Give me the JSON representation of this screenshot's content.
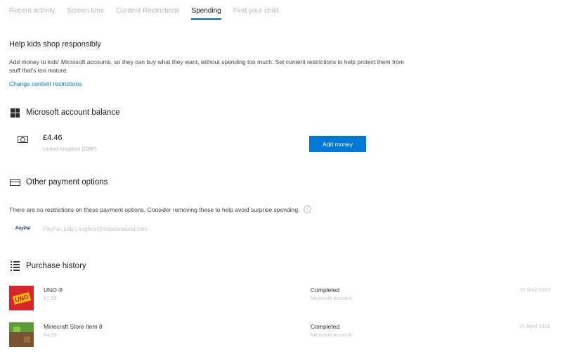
{
  "tabs": [
    "Recent activity",
    "Screen time",
    "Content Restrictions",
    "Spending",
    "Find your child"
  ],
  "help": {
    "title": "Help kids shop responsibly",
    "description": "Add money to kids' Microsoft accounts, so they can buy what they want, without spending too much. Set content restrictions to help protect them from stuff that's too mature.",
    "link": "Change content restrictions"
  },
  "balance": {
    "title": "Microsoft account balance",
    "amount": "£4.46",
    "region": "United Kingdom (GBP)",
    "add_button": "Add money"
  },
  "payment": {
    "title": "Other payment options",
    "note": "There are no restrictions on these payment options. Consider removing these to help avoid surprise spending.",
    "paypal_logo": "PayPal",
    "paypal_account": "PayPal: judy.j.hughes@hispanoworld.com"
  },
  "history": {
    "title": "Purchase history",
    "items": [
      {
        "name": "UNO ®",
        "price": "£7.99",
        "status": "Completed",
        "method": "Microsoft account",
        "date": "31 May 2018"
      },
      {
        "name": "Minecraft Store Item 8",
        "price": "£4.59",
        "status": "Completed",
        "method": "Microsoft account",
        "date": "21 April 2018"
      }
    ]
  },
  "icons": {
    "balance": "windows-logo-icon",
    "money": "money-icon",
    "payment": "card-icon",
    "history": "list-icon",
    "info": "info-icon"
  },
  "colors": {
    "accent": "#0078d4",
    "tab_underline": "#0067b8"
  }
}
